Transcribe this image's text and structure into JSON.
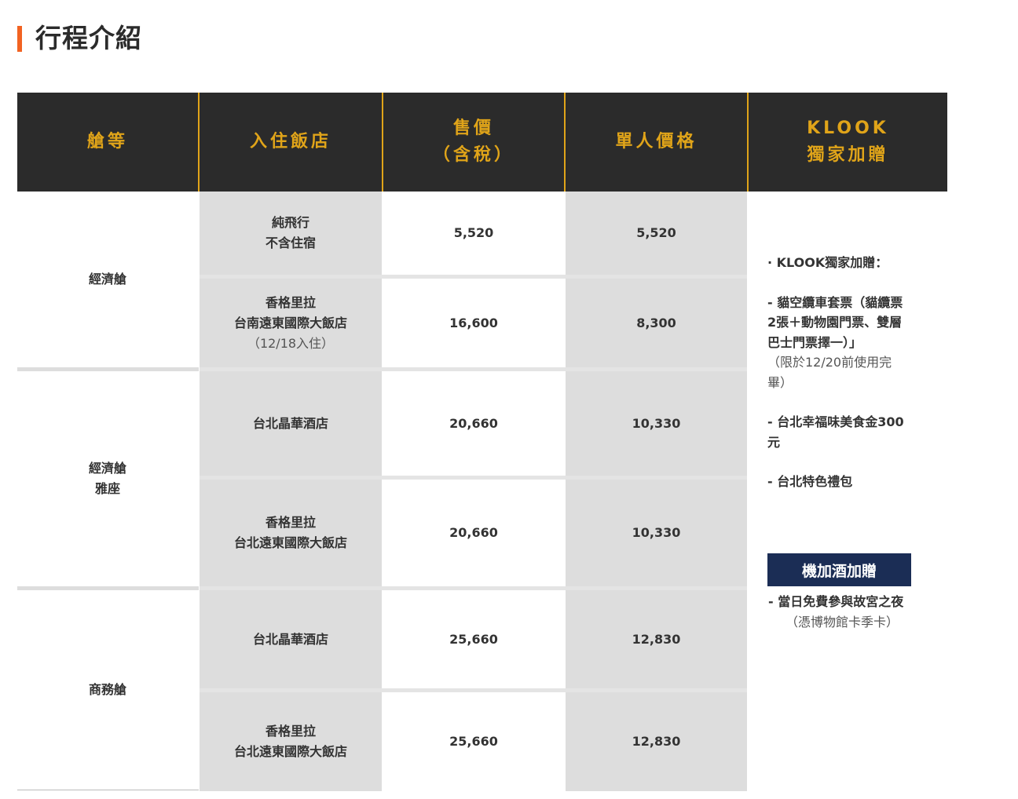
{
  "page": {
    "title": "行程介紹",
    "accent_color": "#f26322"
  },
  "table": {
    "header_bg": "#2b2b2b",
    "header_color": "#e0a419",
    "headers": {
      "cabin": "艙等",
      "hotel": "入住飯店",
      "price_line1": "售價",
      "price_line2": "（含稅）",
      "per_person": "單人價格",
      "klook_line1": "KLOOK",
      "klook_line2": "獨家加贈"
    },
    "cabins": [
      "經濟艙",
      "經濟艙",
      "雅座",
      "商務艙"
    ],
    "rows": [
      {
        "hotel1": "純飛行",
        "hotel2": "不含住宿",
        "price": "5,520",
        "per_person": "5,520"
      },
      {
        "hotel1": "香格里拉",
        "hotel2": "台南遠東國際大飯店",
        "hotel_note": "（12/18入住）",
        "price": "16,600",
        "per_person": "8,300"
      },
      {
        "hotel1": "台北晶華酒店",
        "price": "20,660",
        "per_person": "10,330"
      },
      {
        "hotel1": "香格里拉",
        "hotel2": "台北遠東國際大飯店",
        "price": "20,660",
        "per_person": "10,330"
      },
      {
        "hotel1": "台北晶華酒店",
        "price": "25,660",
        "per_person": "12,830"
      },
      {
        "hotel1": "香格里拉",
        "hotel2": "台北遠東國際大飯店",
        "price": "25,660",
        "per_person": "12,830"
      }
    ],
    "klook_gift": {
      "heading": "· KLOOK獨家加贈：",
      "item1_l1": "- 貓空纜車套票（貓纜票",
      "item1_l2": "2張＋動物園門票、雙層",
      "item1_l3": "巴士門票擇一）」",
      "item1_note_l1": "（限於12/20前使用完",
      "item1_note_l2": "畢）",
      "item2_l1": "- 台北幸福味美食金300",
      "item2_l2": "元",
      "item3": "- 台北特色禮包",
      "button_label": "機加酒加贈",
      "button_color": "#1b2d55",
      "bonus_l1": "- 當日免費參與故宮之夜",
      "bonus_l2": "（憑博物館卡季卡）"
    }
  }
}
